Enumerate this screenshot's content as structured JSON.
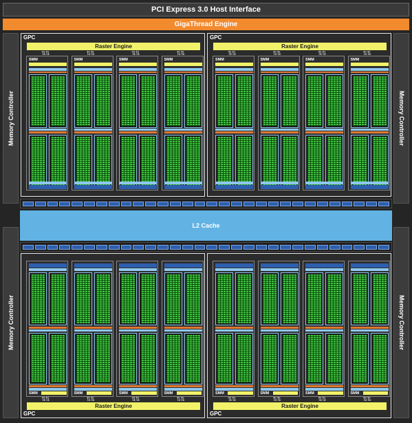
{
  "header": {
    "pcie_label": "PCI Express 3.0 Host Interface",
    "gigathread_label": "GigaThread Engine"
  },
  "memory_controller_label": "Memory Controller",
  "l2_cache_label": "L2 Cache",
  "gpc_label": "GPC",
  "raster_engine_label": "Raster Engine",
  "smm_label": "SMM",
  "colors": {
    "background": "#252525",
    "gigathread": "#f28a2e",
    "raster_engine": "#f2f26a",
    "l2_cache": "#62b3e3",
    "core": "#40c040",
    "register": "#2d5fae",
    "load_store": "#e07a30",
    "light_blue_unit": "#8ec8ef"
  }
}
